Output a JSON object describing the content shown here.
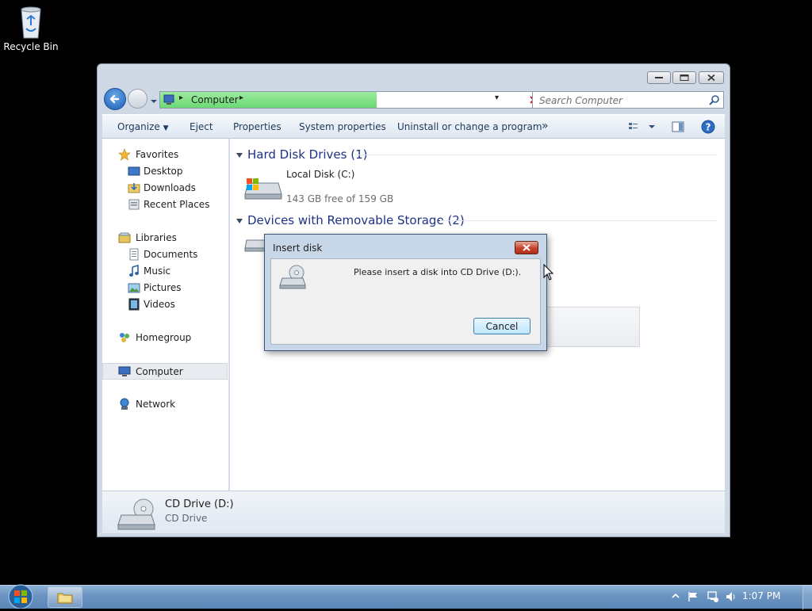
{
  "desktop": {
    "recycle_bin_label": "Recycle Bin"
  },
  "window": {
    "breadcrumb": "Computer",
    "address_progress": 0.59,
    "search_placeholder": "Search Computer",
    "toolbar": {
      "organize": "Organize",
      "eject": "Eject",
      "properties": "Properties",
      "system_properties": "System properties",
      "uninstall": "Uninstall or change a program",
      "more": "»"
    },
    "nav": {
      "favorites": "Favorites",
      "desktop": "Desktop",
      "downloads": "Downloads",
      "recent_places": "Recent Places",
      "libraries": "Libraries",
      "documents": "Documents",
      "music": "Music",
      "pictures": "Pictures",
      "videos": "Videos",
      "homegroup": "Homegroup",
      "computer": "Computer",
      "network": "Network"
    },
    "groups": {
      "hard_disk": "Hard Disk Drives (1)",
      "removable": "Devices with Removable Storage (2)"
    },
    "local_disk": {
      "name": "Local Disk (C:)",
      "free_text": "143 GB free of 159 GB",
      "used_fraction": 0.1
    },
    "details": {
      "name": "CD Drive (D:)",
      "type": "CD Drive"
    }
  },
  "dialog": {
    "title": "Insert disk",
    "message": "Please insert a disk into CD Drive (D:).",
    "cancel_label": "Cancel"
  },
  "taskbar": {
    "clock": "1:07 PM"
  },
  "colors": {
    "accent": "#1e3287",
    "progress_green": "#6cd974",
    "disk_blue": "#1c95d2"
  }
}
